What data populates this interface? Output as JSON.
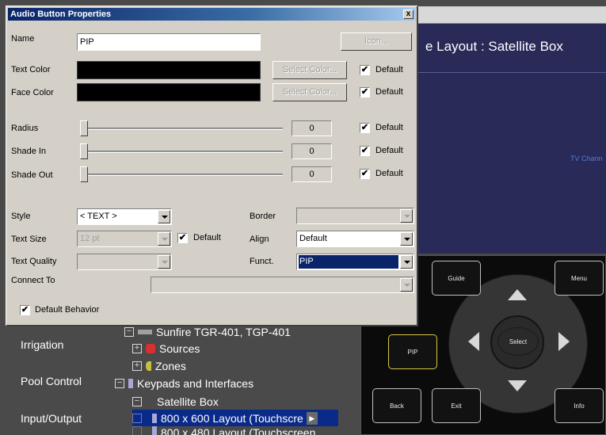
{
  "dialog": {
    "title": "Audio Button Properties",
    "close_glyph": "x",
    "name_label": "Name",
    "name_value": "PIP",
    "icon_button": "Icon...",
    "text_color_label": "Text Color",
    "face_color_label": "Face Color",
    "text_color_value": "#000000",
    "face_color_value": "#000000",
    "select_color_button": "Select Color...",
    "default_label": "Default",
    "check_glyph": "✔",
    "sliders": [
      {
        "label": "Radius",
        "value": "0",
        "default_checked": true
      },
      {
        "label": "Shade In",
        "value": "0",
        "default_checked": true
      },
      {
        "label": "Shade Out",
        "value": "0",
        "default_checked": true
      }
    ],
    "style_label": "Style",
    "style_value": "< TEXT >",
    "text_size_label": "Text Size",
    "text_size_value": "12 pt",
    "text_quality_label": "Text Quality",
    "text_quality_value": "",
    "border_label": "Border",
    "border_value": "",
    "align_label": "Align",
    "align_value": "Default",
    "funct_label": "Funct.",
    "funct_value": "PIP",
    "connect_to_label": "Connect To",
    "connect_to_value": "",
    "default_behavior_label": "Default Behavior",
    "default_behavior_checked": true
  },
  "preview": {
    "title": "e Layout : Satellite Box",
    "tv_channel_label": "TV Chann"
  },
  "remote": {
    "guide": "Guide",
    "menu": "Menu",
    "select": "Select",
    "pip": "PIP",
    "back": "Back",
    "exit": "Exit",
    "info": "Info"
  },
  "nav": {
    "items": [
      "Irrigation",
      "Pool Control",
      "Input/Output"
    ]
  },
  "tree": {
    "rows": [
      {
        "expander": "−",
        "text": "Sunfire TGR-401, TGP-401"
      },
      {
        "expander": "+",
        "text": "Sources",
        "icon_color": "#d83030"
      },
      {
        "expander": "+",
        "text": "Zones",
        "icon_color": "#c8c040"
      },
      {
        "expander": "−",
        "text": "Keypads and Interfaces",
        "icon_color": "#a8a8d8"
      },
      {
        "expander": "−",
        "text": "Satellite Box"
      },
      {
        "expander": "",
        "text": "800 x 600 Layout (Touchscre",
        "icon_color": "#a8a8d8"
      },
      {
        "expander": "",
        "text": "800 x 480 Layout (Touchscreen",
        "icon_color": "#a8a8d8"
      }
    ],
    "scroll_arrow": "▶"
  }
}
